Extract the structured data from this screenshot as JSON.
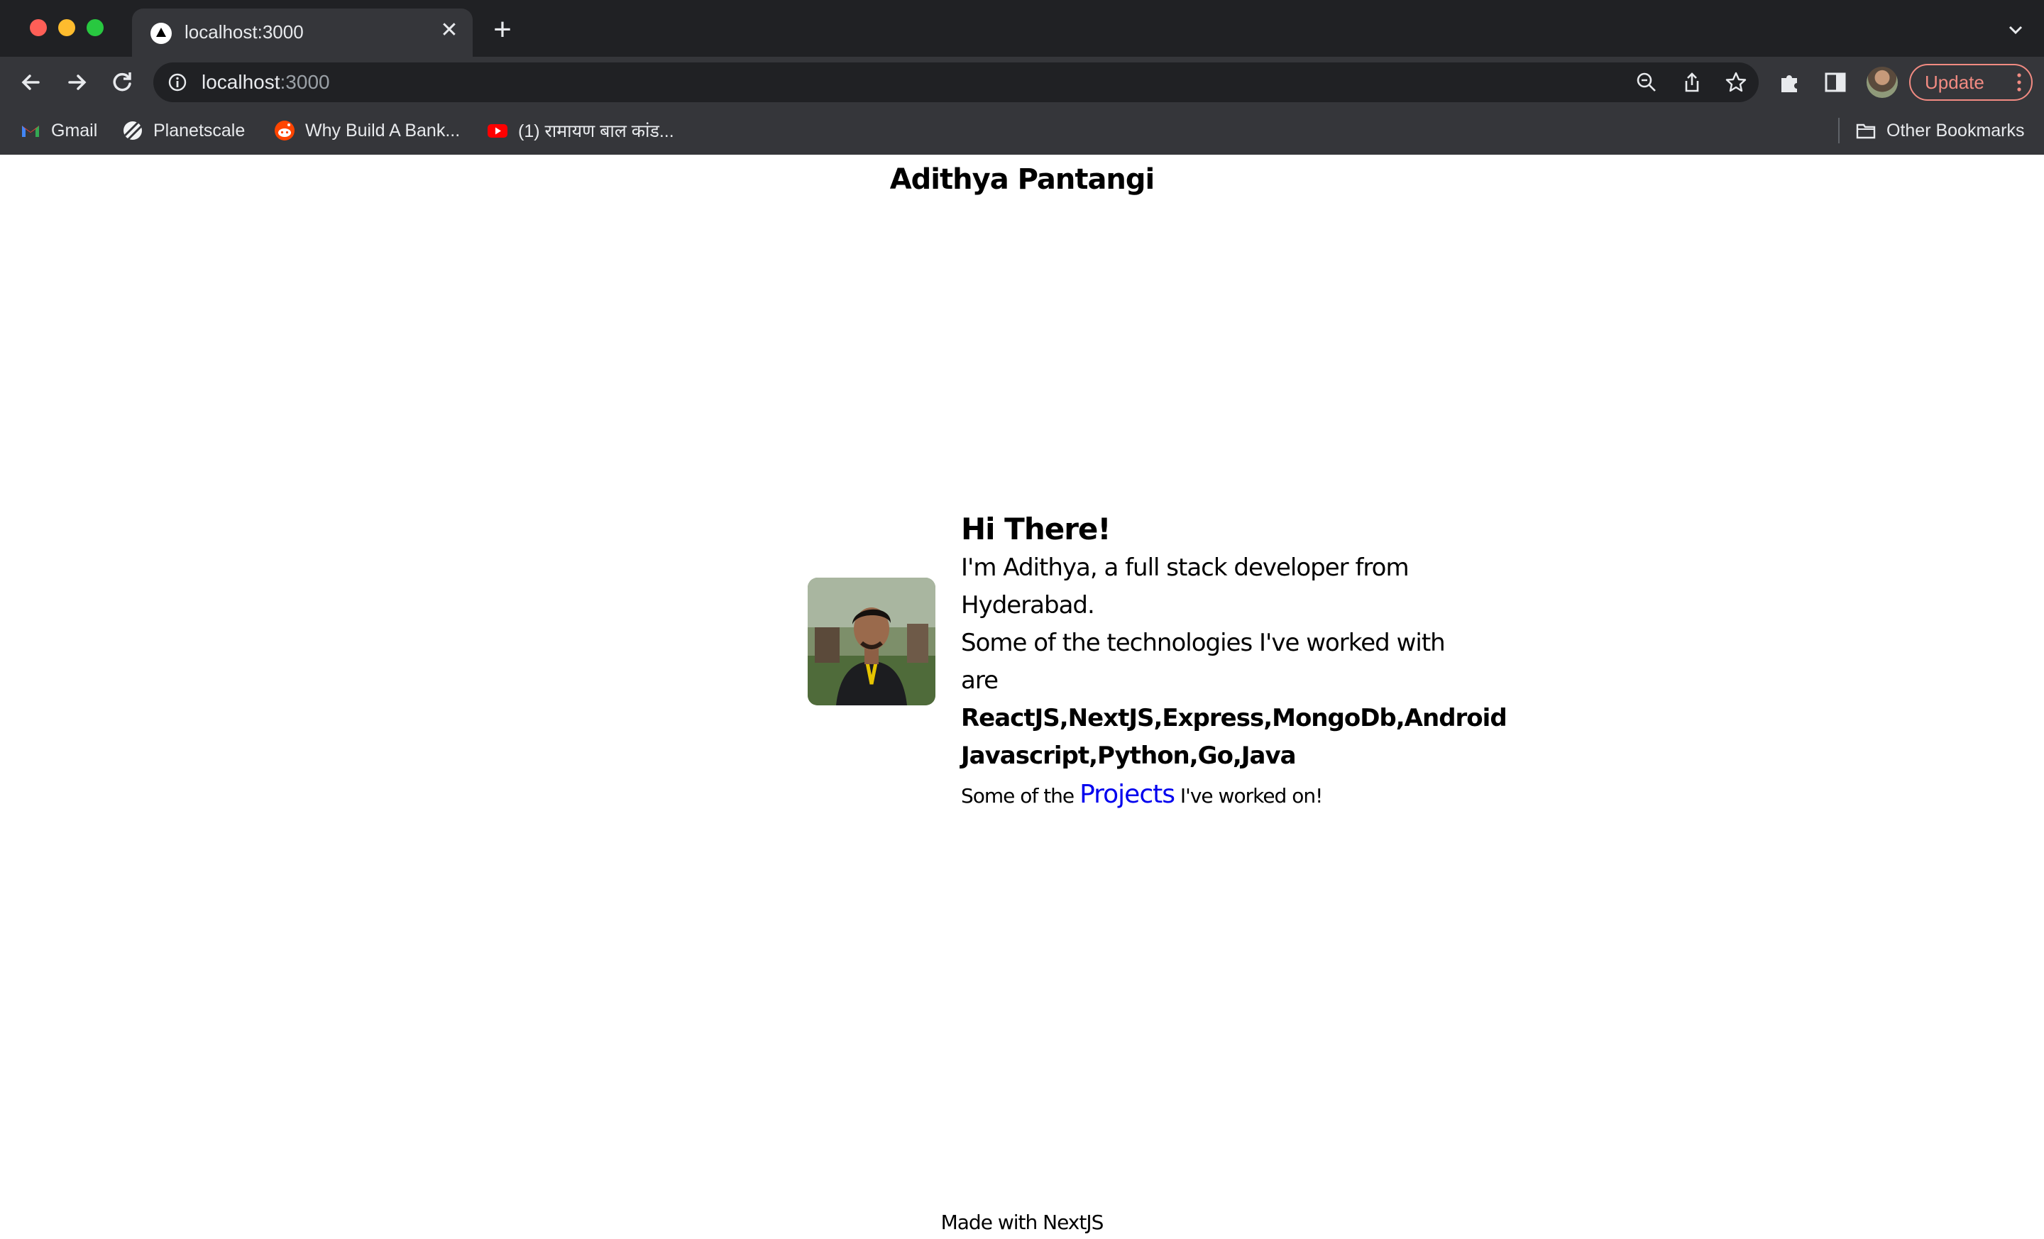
{
  "browser": {
    "tab_title": "localhost:3000",
    "url_host": "localhost",
    "url_port": ":3000",
    "update_label": "Update",
    "bookmarks": [
      {
        "label": "Gmail",
        "icon": "gmail-icon"
      },
      {
        "label": "Planetscale",
        "icon": "planetscale-icon"
      },
      {
        "label": "Why Build A Bank...",
        "icon": "reddit-icon"
      },
      {
        "label": "(1) रामायण बाल कांड...",
        "icon": "youtube-icon"
      }
    ],
    "other_bookmarks": "Other Bookmarks"
  },
  "page": {
    "site_title": "Adithya Pantangi",
    "greeting": "Hi There!",
    "intro_line1": "I'm Adithya, a full stack developer from",
    "intro_line2": "Hyderabad.",
    "tech_intro": "Some of the technologies I've worked with are",
    "tech_list1": "ReactJS,NextJS,Express,MongoDb,Android",
    "tech_list2": "Javascript,Python,Go,Java",
    "projects_prefix": "Some of the",
    "projects_link": "Projects",
    "projects_suffix": "I've worked on!",
    "footer": "Made with NextJS"
  },
  "colors": {
    "tabstrip": "#202124",
    "toolbar": "#35363a",
    "link": "#0000ee",
    "update_accent": "#f28b82"
  }
}
